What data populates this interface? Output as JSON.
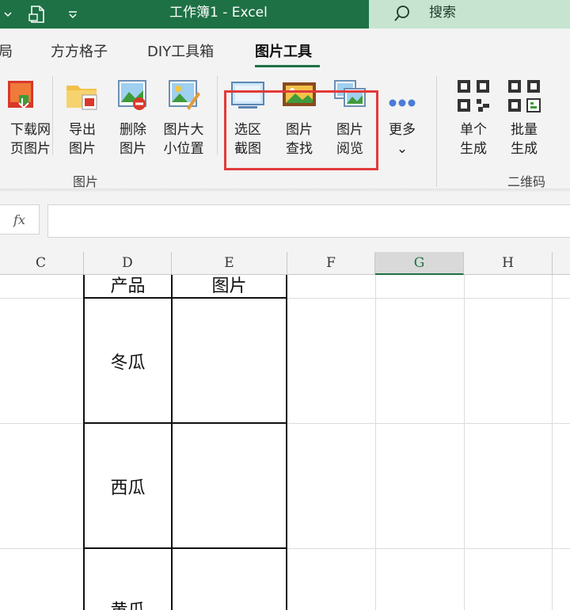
{
  "titlebar": {
    "title": "工作簿1  -  Excel",
    "search_label": "搜索",
    "qa_dropdown_icon": "chevron-down-icon",
    "qa_document_icon": "document-icon",
    "qa_customize_icon": "customize-dropdown-icon"
  },
  "tabs": [
    {
      "label": "局",
      "active": false
    },
    {
      "label": "方方格子",
      "active": false
    },
    {
      "label": "DIY工具箱",
      "active": false
    },
    {
      "label": "图片工具",
      "active": true
    }
  ],
  "ribbon": {
    "buttons": [
      {
        "label": "下载网\n页图片",
        "icon": "download-image-icon"
      },
      {
        "label": "导出\n图片",
        "icon": "export-image-icon"
      },
      {
        "label": "删除\n图片",
        "icon": "delete-image-icon"
      },
      {
        "label": "图片大\n小位置",
        "icon": "image-size-icon"
      },
      {
        "label": "选区\n截图",
        "icon": "screenshot-icon"
      },
      {
        "label": "图片\n查找",
        "icon": "image-find-icon"
      },
      {
        "label": "图片\n阅览",
        "icon": "image-browse-icon"
      },
      {
        "label": "更多\n⌄",
        "icon": "more-dots-icon"
      },
      {
        "label": "单个\n生成",
        "icon": "qr-code-icon"
      },
      {
        "label": "批量\n生成",
        "icon": "qr-batch-icon"
      }
    ],
    "groups": [
      {
        "label": "图片"
      },
      {
        "label": "二维码"
      }
    ]
  },
  "formula_bar": {
    "fx_label": "fx",
    "value": ""
  },
  "grid": {
    "columns": [
      "C",
      "D",
      "E",
      "F",
      "G",
      "H"
    ],
    "selected_column": "G",
    "table": {
      "headers": [
        "产品",
        "图片"
      ],
      "rows": [
        {
          "product": "冬瓜",
          "image": ""
        },
        {
          "product": "西瓜",
          "image": ""
        },
        {
          "product": "黄瓜",
          "image": ""
        }
      ]
    }
  },
  "colors": {
    "excel_green": "#1e7145",
    "search_bg": "#c6e4d0",
    "highlight_red": "#e23a3a"
  }
}
